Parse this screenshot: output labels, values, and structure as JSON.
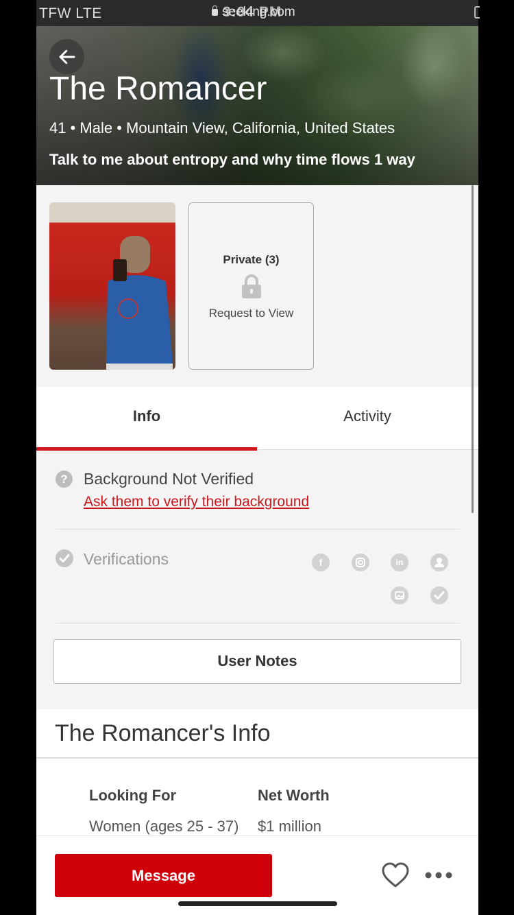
{
  "status_bar": {
    "carrier": "TFW  LTE",
    "url": "seeking.com",
    "time": "3:04 PM"
  },
  "profile": {
    "name": "The Romancer",
    "meta": "41 • Male • Mountain View, California, United States",
    "tagline": "Talk to me about entropy and why time flows 1 way"
  },
  "photos": {
    "private_label": "Private (3)",
    "request_label": "Request to View"
  },
  "tabs": [
    {
      "label": "Info",
      "active": true
    },
    {
      "label": "Activity",
      "active": false
    }
  ],
  "background": {
    "status": "Background Not Verified",
    "link": "Ask them to verify their background"
  },
  "verifications": {
    "label": "Verifications",
    "icons": [
      "facebook-icon",
      "instagram-icon",
      "linkedin-icon",
      "profile-icon",
      "photo-icon",
      "verified-icon"
    ]
  },
  "user_notes_label": "User Notes",
  "info": {
    "header": "The Romancer's Info",
    "looking_for_label": "Looking For",
    "looking_for_value": "Women (ages 25 - 37)",
    "net_worth_label": "Net Worth",
    "net_worth_value": "$1 million"
  },
  "actions": {
    "message_label": "Message"
  },
  "colors": {
    "accent": "#d0000b",
    "tab_indicator": "#d0181c",
    "link": "#c8181c"
  }
}
